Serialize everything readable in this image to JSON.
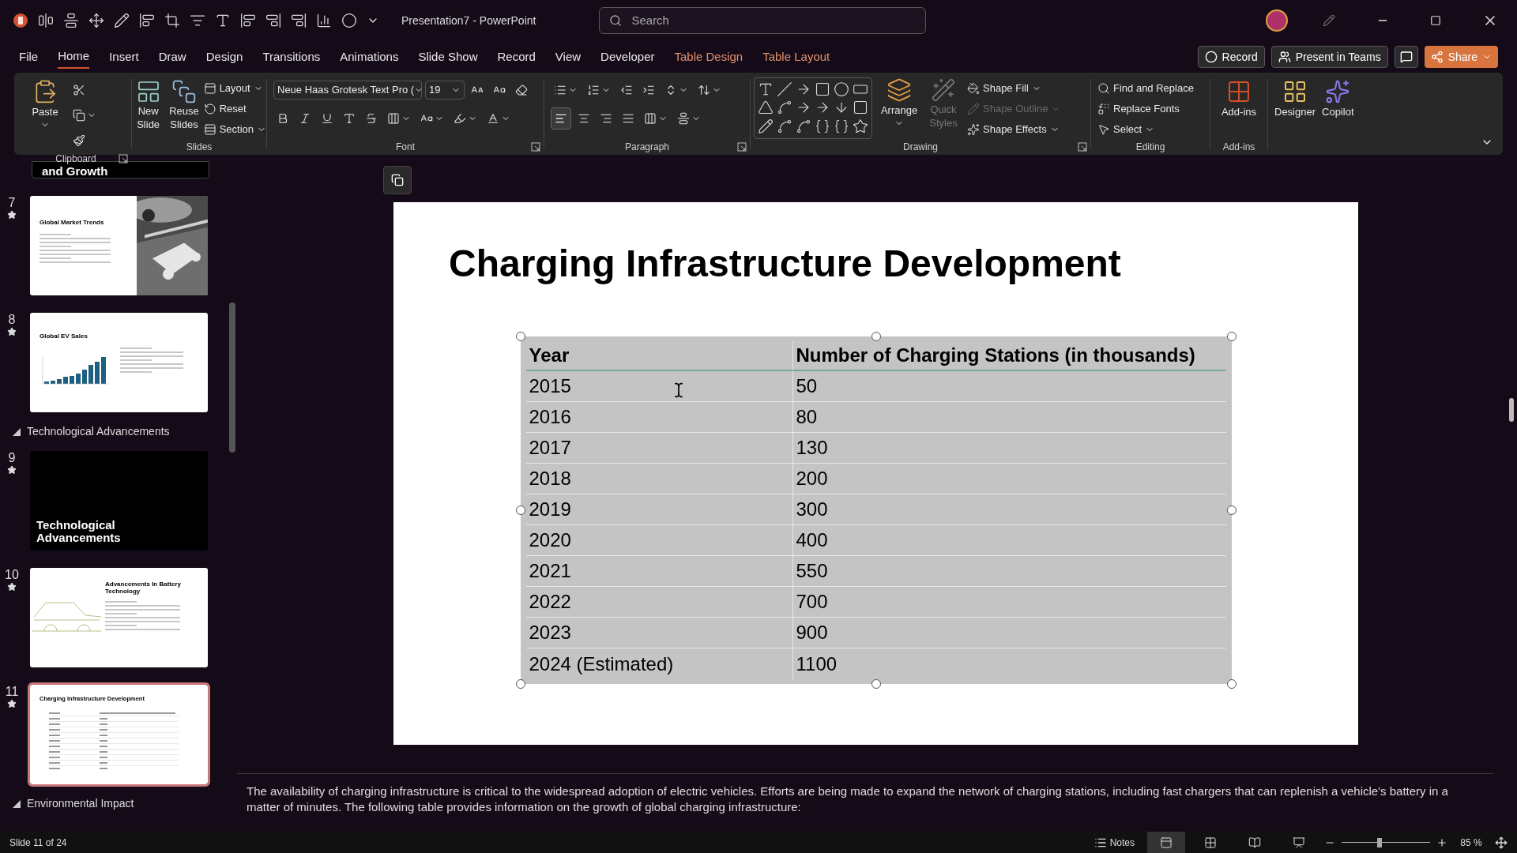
{
  "window": {
    "title": "Presentation7  -  PowerPoint"
  },
  "search": {
    "placeholder": "Search"
  },
  "menu_tabs": [
    {
      "label": "File",
      "selected": false,
      "kind": "normal"
    },
    {
      "label": "Home",
      "selected": true,
      "kind": "normal"
    },
    {
      "label": "Insert",
      "selected": false,
      "kind": "normal"
    },
    {
      "label": "Draw",
      "selected": false,
      "kind": "normal"
    },
    {
      "label": "Design",
      "selected": false,
      "kind": "normal"
    },
    {
      "label": "Transitions",
      "selected": false,
      "kind": "normal"
    },
    {
      "label": "Animations",
      "selected": false,
      "kind": "normal"
    },
    {
      "label": "Slide Show",
      "selected": false,
      "kind": "normal"
    },
    {
      "label": "Record",
      "selected": false,
      "kind": "normal"
    },
    {
      "label": "View",
      "selected": false,
      "kind": "normal"
    },
    {
      "label": "Developer",
      "selected": false,
      "kind": "normal"
    },
    {
      "label": "Table Design",
      "selected": false,
      "kind": "contextual"
    },
    {
      "label": "Table Layout",
      "selected": false,
      "kind": "contextual"
    }
  ],
  "header_buttons": [
    {
      "label": "Record",
      "kind": "record"
    },
    {
      "label": "Present in Teams",
      "kind": "teams"
    },
    {
      "label": "Share",
      "kind": "share"
    }
  ],
  "ribbon": {
    "clipboard": {
      "label": "Clipboard",
      "paste": "Paste"
    },
    "slides": {
      "label": "Slides",
      "new_slide": "New Slide",
      "reuse_slides": "Reuse Slides",
      "commands": [
        "Layout",
        "Reset",
        "Section"
      ]
    },
    "font": {
      "label": "Font",
      "font_name": "Neue Haas Grotesk Text Pro (",
      "font_size": "19"
    },
    "paragraph": {
      "label": "Paragraph"
    },
    "drawing": {
      "label": "Drawing",
      "arrange": "Arrange",
      "quick_styles": "Quick Styles",
      "commands": [
        {
          "label": "Shape Fill",
          "disabled": false
        },
        {
          "label": "Shape Outline",
          "disabled": true
        },
        {
          "label": "Shape Effects",
          "disabled": false
        }
      ]
    },
    "editing": {
      "label": "Editing",
      "commands": [
        "Find and Replace",
        "Replace Fonts",
        "Select"
      ]
    },
    "addins": {
      "label": "Add-ins",
      "button": "Add-ins"
    },
    "ai": [
      "Designer",
      "Copilot"
    ]
  },
  "slides_panel": {
    "items": [
      {
        "kind": "partial",
        "title": "and Growth",
        "selected": false
      },
      {
        "number": "7",
        "title": "Global Market Trends",
        "selected": false
      },
      {
        "kind": "chart",
        "number": "8",
        "title": "Global EV Sales",
        "selected": false
      },
      {
        "kind": "section",
        "label": "Technological Advancements"
      },
      {
        "kind": "dark",
        "number": "9",
        "title": "Technological Advancements",
        "selected": false
      },
      {
        "kind": "car",
        "number": "10",
        "title": "Advancements In Battery Technology",
        "selected": false
      },
      {
        "kind": "table",
        "number": "11",
        "title": "Charging Infrastructure Development",
        "selected": true
      },
      {
        "kind": "section",
        "label": "Environmental Impact"
      }
    ]
  },
  "slide": {
    "title": "Charging Infrastructure Development",
    "table": {
      "columns": [
        "Year",
        "Number of Charging Stations (in thousands)"
      ],
      "rows": [
        [
          "2015",
          "50"
        ],
        [
          "2016",
          "80"
        ],
        [
          "2017",
          "130"
        ],
        [
          "2018",
          "200"
        ],
        [
          "2019",
          "300"
        ],
        [
          "2020",
          "400"
        ],
        [
          "2021",
          "550"
        ],
        [
          "2022",
          "700"
        ],
        [
          "2023",
          "900"
        ],
        [
          "2024 (Estimated)",
          "1100"
        ]
      ]
    }
  },
  "notes": "The availability of charging infrastructure is critical to the widespread adoption of electric vehicles. Efforts are being made to expand the network of charging stations, including fast chargers that can replenish a vehicle's battery in a matter of minutes. The following table provides information on the growth of global charging infrastructure:",
  "status_bar": {
    "slide_info": "Slide 11 of 24",
    "notes_label": "Notes",
    "views": [
      {
        "kind": "normal",
        "selected": true
      },
      {
        "kind": "sorter",
        "selected": false
      },
      {
        "kind": "reading",
        "selected": false
      },
      {
        "kind": "slideshow",
        "selected": false
      }
    ],
    "zoom": {
      "level": 0.43,
      "reading": "85 %"
    }
  }
}
